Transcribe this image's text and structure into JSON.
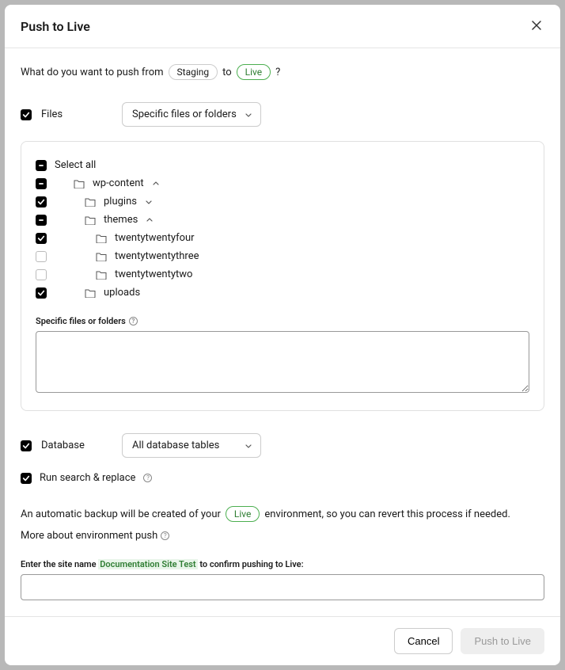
{
  "header": {
    "title": "Push to Live"
  },
  "question": {
    "prefix": "What do you want to push from",
    "from": "Staging",
    "to_word": "to",
    "to": "Live",
    "suffix": "?"
  },
  "files": {
    "checkbox_label": "Files",
    "select_value": "Specific files or folders",
    "tree": {
      "select_all": "Select all",
      "wp_content": "wp-content",
      "plugins": "plugins",
      "themes": "themes",
      "twentytwentyfour": "twentytwentyfour",
      "twentytwentythree": "twentytwentythree",
      "twentytwentytwo": "twentytwentytwo",
      "uploads": "uploads"
    },
    "specific_label": "Specific files or folders"
  },
  "database": {
    "checkbox_label": "Database",
    "select_value": "All database tables"
  },
  "search_replace": {
    "label": "Run search & replace"
  },
  "backup": {
    "prefix": "An automatic backup will be created of your",
    "env": "Live",
    "suffix": "environment, so you can revert this process if needed."
  },
  "learn_more": "More about environment push",
  "confirm": {
    "prefix": "Enter the site name ",
    "site_name": "Documentation Site Test",
    "suffix": " to confirm pushing to Live:"
  },
  "footer": {
    "cancel": "Cancel",
    "push": "Push to Live"
  }
}
